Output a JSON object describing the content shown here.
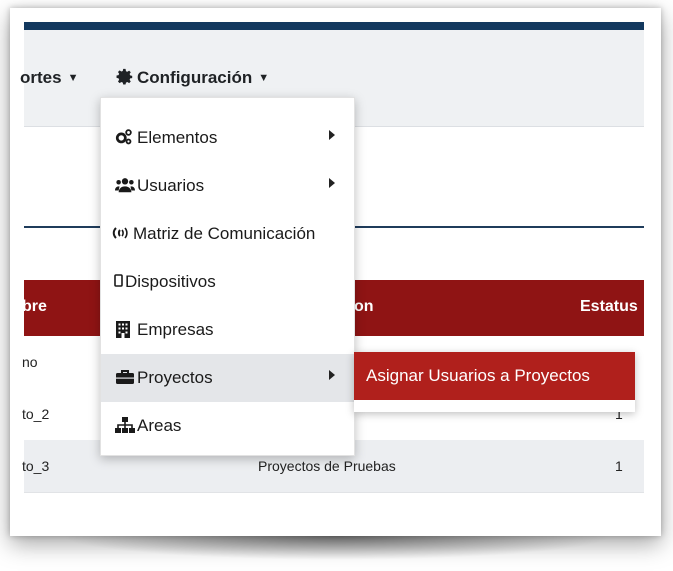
{
  "navbar": {
    "reportes_label": "ortes",
    "config_label": "Configuración"
  },
  "table": {
    "headers": {
      "nombre": "bre",
      "descripcion": "on",
      "estatus": "Estatus"
    },
    "rows": [
      {
        "nombre": "no",
        "descripcion": "",
        "estatus": ""
      },
      {
        "nombre": "to_2",
        "descripcion": "",
        "estatus": "1"
      },
      {
        "nombre": "to_3",
        "descripcion": "Proyectos de Pruebas",
        "estatus": "1"
      }
    ]
  },
  "dropdown": {
    "items": [
      {
        "label": "Elementos",
        "icon": "cogs-icon",
        "has_submenu": true
      },
      {
        "label": "Usuarios",
        "icon": "users-icon",
        "has_submenu": true
      },
      {
        "label": "Matriz de Comunicación",
        "icon": "signal-icon",
        "has_submenu": false
      },
      {
        "label": "Dispositivos",
        "icon": "mobile-icon",
        "has_submenu": false
      },
      {
        "label": "Empresas",
        "icon": "building-icon",
        "has_submenu": false
      },
      {
        "label": "Proyectos",
        "icon": "briefcase-icon",
        "has_submenu": true
      },
      {
        "label": "Areas",
        "icon": "sitemap-icon",
        "has_submenu": false
      }
    ]
  },
  "submenu": {
    "label": "Asignar Usuarios a Proyectos"
  },
  "colors": {
    "navy": "#13395f",
    "table_header": "#8f1414",
    "submenu_button": "#b0201c",
    "hover_row": "#e4e6e9"
  }
}
